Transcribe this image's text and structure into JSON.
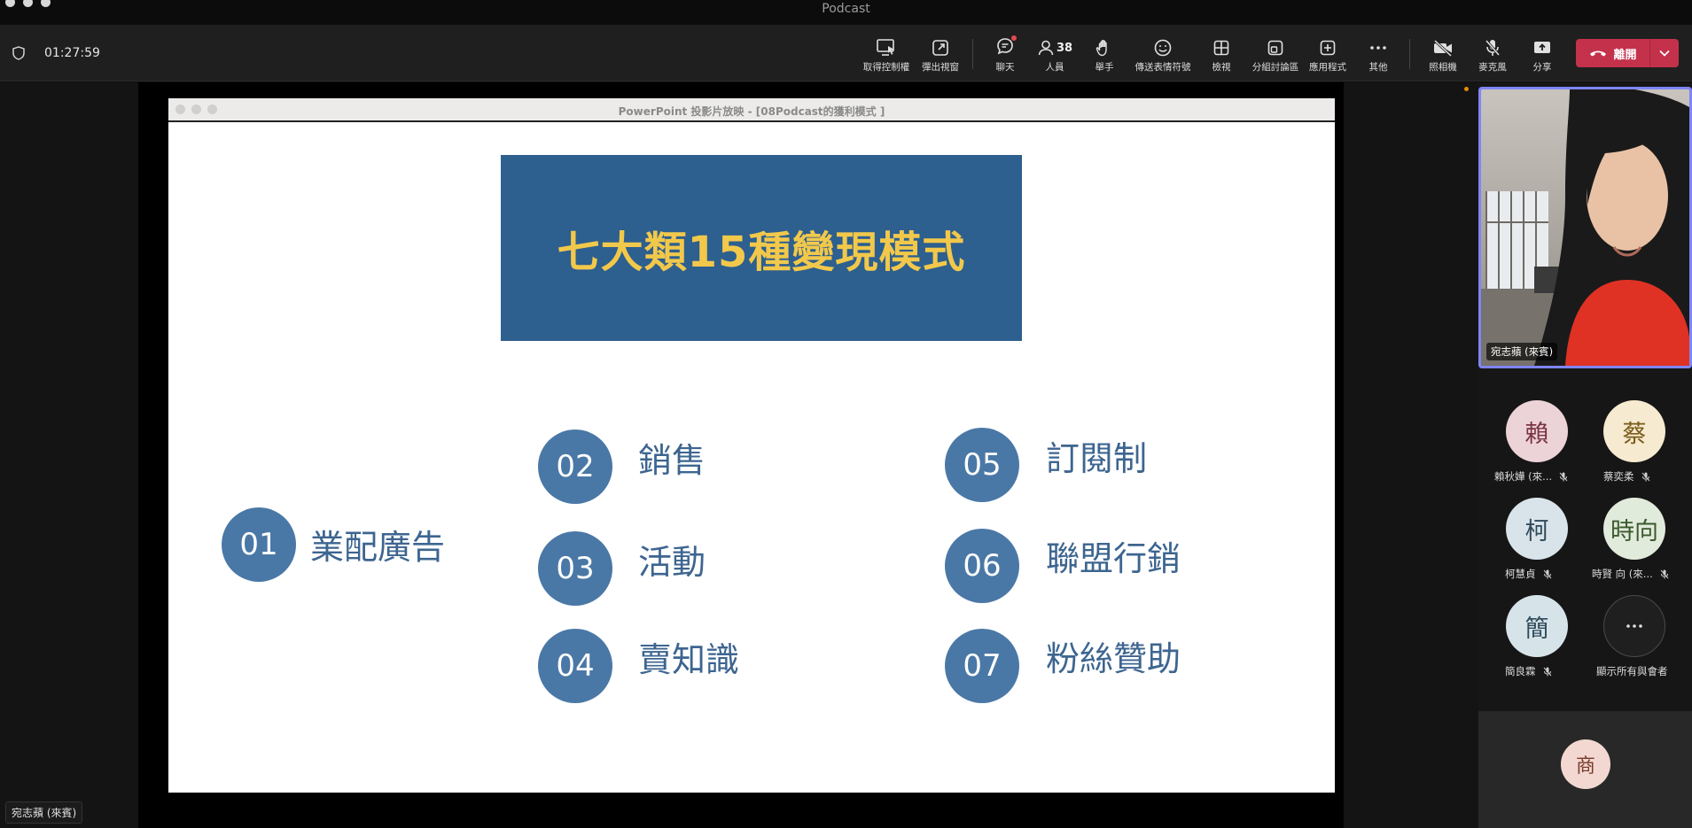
{
  "window": {
    "title": "Podcast"
  },
  "meeting": {
    "elapsed": "01:27:59"
  },
  "toolbar": {
    "take_control": "取得控制權",
    "popout": "彈出視窗",
    "chat": "聊天",
    "people": "人員",
    "people_count": "38",
    "raise_hand": "舉手",
    "reactions": "傳送表情符號",
    "view": "檢視",
    "breakout": "分組討論區",
    "apps": "應用程式",
    "more": "其他",
    "camera": "照相機",
    "mic": "麥克風",
    "share": "分享",
    "leave": "離開"
  },
  "ppt": {
    "window_title": "PowerPoint 投影片放映 - [08Podcast的獲利模式 ]",
    "slide_title": "七大類15種變現模式",
    "items": [
      {
        "num": "01",
        "label": "業配廣告"
      },
      {
        "num": "02",
        "label": "銷售"
      },
      {
        "num": "03",
        "label": "活動"
      },
      {
        "num": "04",
        "label": "賣知識"
      },
      {
        "num": "05",
        "label": "訂閱制"
      },
      {
        "num": "06",
        "label": "聯盟行銷"
      },
      {
        "num": "07",
        "label": "粉絲贊助"
      }
    ]
  },
  "presenter": {
    "name": "宛志蘋 (來賓)"
  },
  "participants": [
    {
      "initial": "賴",
      "name": "賴秋嬅 (來...",
      "bg": "#ecd3d8",
      "fg": "#7a3342"
    },
    {
      "initial": "蔡",
      "name": "蔡奕柔",
      "bg": "#f6ead0",
      "fg": "#7a5a19"
    },
    {
      "initial": "柯",
      "name": "柯慧貞",
      "bg": "#d9e4ea",
      "fg": "#2f4a5a"
    },
    {
      "initial": "時向",
      "name": "時賢 向 (來...",
      "bg": "#e1ebdc",
      "fg": "#3c5a2d"
    },
    {
      "initial": "簡",
      "name": "簡良霖",
      "bg": "#d6e4ea",
      "fg": "#2f4a5a"
    }
  ],
  "show_all": {
    "label": "顯示所有與會者"
  },
  "bottom_avatar": {
    "initial": "商",
    "bg": "#f3d8d2",
    "fg": "#7a3a2c"
  }
}
